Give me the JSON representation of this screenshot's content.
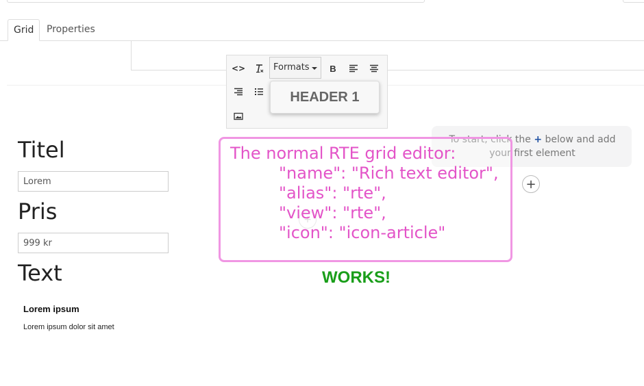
{
  "tabs": [
    {
      "label": "Grid",
      "active": true
    },
    {
      "label": "Properties",
      "active": false
    }
  ],
  "toolbar": {
    "source_code": "<>",
    "formats_label": "Formats",
    "bold": "B",
    "dropdown_item": "HEADER 1"
  },
  "form": {
    "title_label": "Titel",
    "title_value": "Lorem",
    "price_label": "Pris",
    "price_value": "999 kr",
    "text_label": "Text",
    "text_heading": "Lorem ipsum",
    "text_body": "Lorem ipsum dolor sit amet"
  },
  "placeholder": {
    "before": "To start, click the ",
    "plus": "+",
    "after": " below and add your first element",
    "add_button": "+"
  },
  "annotation": {
    "lines": [
      "The normal RTE grid editor:",
      "\"name\": \"Rich text editor\",",
      "\"alias\": \"rte\",",
      "\"view\": \"rte\",",
      "\"icon\": \"icon-article\""
    ],
    "status": "WORKS!"
  },
  "colors": {
    "annotation": "#e354c8",
    "annotation_border": "#f096e3",
    "works": "#1a9e1a",
    "accent": "#2152a3"
  }
}
